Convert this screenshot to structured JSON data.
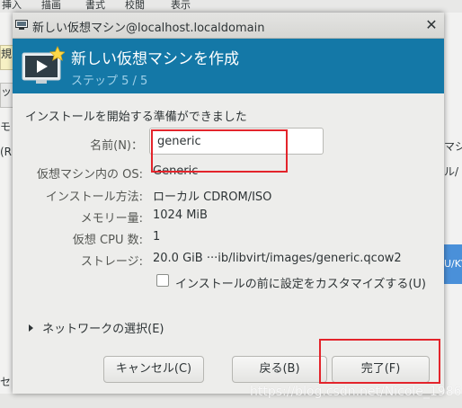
{
  "background": {
    "menu_items": [
      "挿入",
      "描画",
      "書式",
      "校閲",
      "表示"
    ],
    "left_fragments": [
      "規",
      "ッ",
      "モ",
      "(R"
    ],
    "right_fragments": [
      "マシ",
      "ル/",
      "U/KV"
    ],
    "bottom_left_fragment": "セ"
  },
  "dialog": {
    "window_title": "新しい仮想マシン@localhost.localdomain",
    "close_symbol": "✕",
    "header_title": "新しい仮想マシンを作成",
    "step_text": "ステップ 5 / 5",
    "ready_text": "インストールを開始する準備ができました",
    "name_label": "名前(N)：",
    "name_value": "generic",
    "details": [
      {
        "label": "仮想マシン内の OS:",
        "value": "Generic"
      },
      {
        "label": "インストール方法:",
        "value": "ローカル CDROM/ISO"
      },
      {
        "label": "メモリー量:",
        "value": "1024 MiB"
      },
      {
        "label": "仮想 CPU 数:",
        "value": "1"
      },
      {
        "label": "ストレージ:",
        "value": "20.0 GiB  ···ib/libvirt/images/generic.qcow2"
      }
    ],
    "customize_checkbox": {
      "label": "インストールの前に設定をカスタマイズする(U)",
      "checked": false
    },
    "network_expander": "ネットワークの選択(E)",
    "buttons": {
      "cancel": "キャンセル(C)",
      "back": "戻る(B)",
      "finish": "完了(F)"
    },
    "header_color": "#1478a7",
    "annotation_color": "#e3242b"
  },
  "watermark": "https://blog.csdn.net/Nicole_1986"
}
